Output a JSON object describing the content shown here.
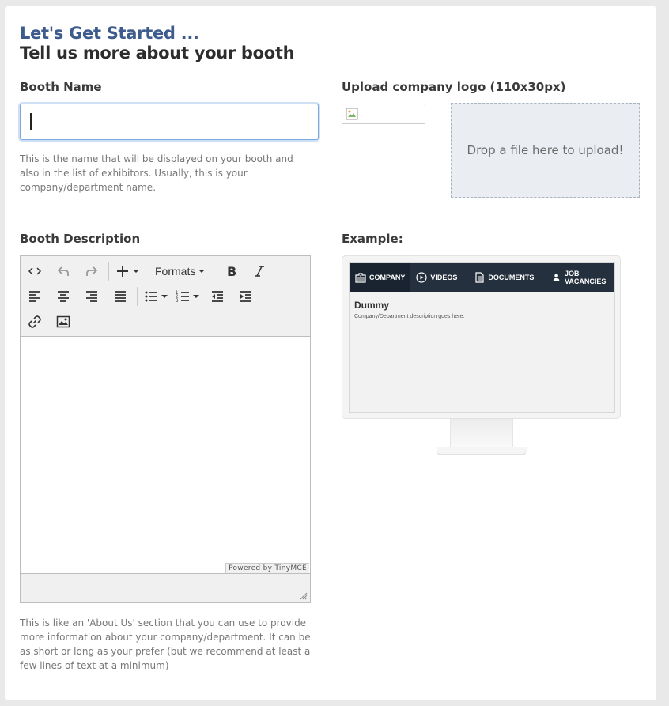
{
  "header": {
    "title": "Let's Get Started ...",
    "subtitle": "Tell us more about your booth"
  },
  "booth_name": {
    "label": "Booth Name",
    "value": "",
    "help": "This is the name that will be displayed on your booth and also in the list of exhibitors. Usually, this is your company/department name."
  },
  "logo": {
    "label": "Upload company logo (110x30px)",
    "dropzone_text": "Drop a file here to upload!"
  },
  "description": {
    "label": "Booth Description",
    "formats_label": "Formats",
    "powered_by": "Powered by TinyMCE",
    "help": "This is like an 'About Us' section that you can use to provide more information about your company/department. It can be as short or long as your prefer (but we recommend at least a few lines of text at a minimum)"
  },
  "example": {
    "label": "Example:",
    "nav": [
      "COMPANY",
      "VIDEOS",
      "DOCUMENTS",
      "JOB VACANCIES"
    ],
    "screen_title": "Dummy",
    "screen_desc": "Company/Department description goes here."
  },
  "colors": {
    "title_blue": "#3d5b8c",
    "nav_bg": "#24303d",
    "dropzone_bg": "#eaedf2"
  }
}
